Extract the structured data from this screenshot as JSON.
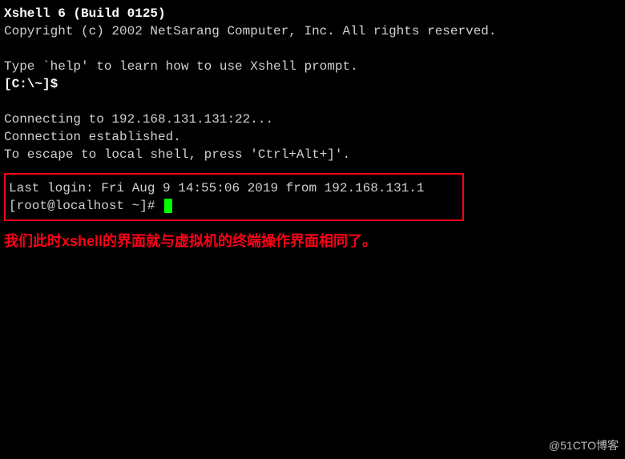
{
  "header": {
    "title": "Xshell 6 (Build 0125)",
    "copyright": "Copyright (c) 2002 NetSarang Computer, Inc. All rights reserved."
  },
  "tip": "Type `help' to learn how to use Xshell prompt.",
  "local_prompt": "[C:\\~]$",
  "connection": {
    "connecting": "Connecting to 192.168.131.131:22...",
    "established": "Connection established.",
    "escape": "To escape to local shell, press 'Ctrl+Alt+]'."
  },
  "session": {
    "last_login": "Last login: Fri Aug  9 14:55:06 2019 from 192.168.131.1",
    "remote_prompt": "[root@localhost ~]#"
  },
  "annotation": "我们此时xshell的界面就与虚拟机的终端操作界面相同了。",
  "watermark": "@51CTO博客"
}
